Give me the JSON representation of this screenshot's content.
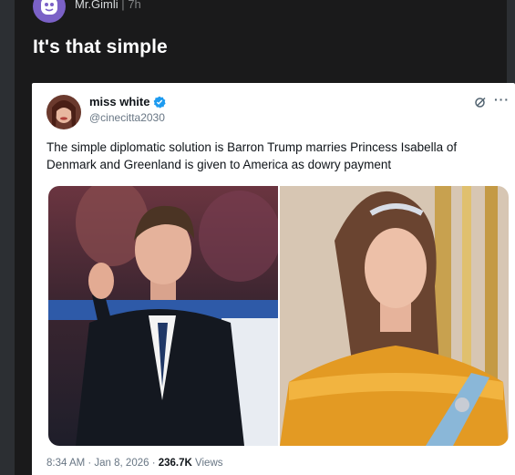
{
  "post": {
    "author": "Mr.Gimli",
    "separator": "|",
    "time": "7h",
    "title": "It's that simple"
  },
  "tweet": {
    "name": "miss white",
    "handle": "@cinecitta2030",
    "text": "The simple diplomatic solution is Barron Trump marries Princess Isabella of Denmark and Greenland is given to America as dowry payment",
    "more": "···",
    "date": "8:34 AM · Jan 8, 2026 · ",
    "views_count": "236.7K",
    "views_label": " Views"
  },
  "icons": {
    "post_avatar": "avatar-icon",
    "verified": "verified-badge-icon",
    "grok": "grok-icon",
    "more": "more-icon"
  },
  "colors": {
    "page_bg": "#1a1a1b",
    "accent_purple": "#7b61c7",
    "verified_blue": "#1d9bf0"
  }
}
